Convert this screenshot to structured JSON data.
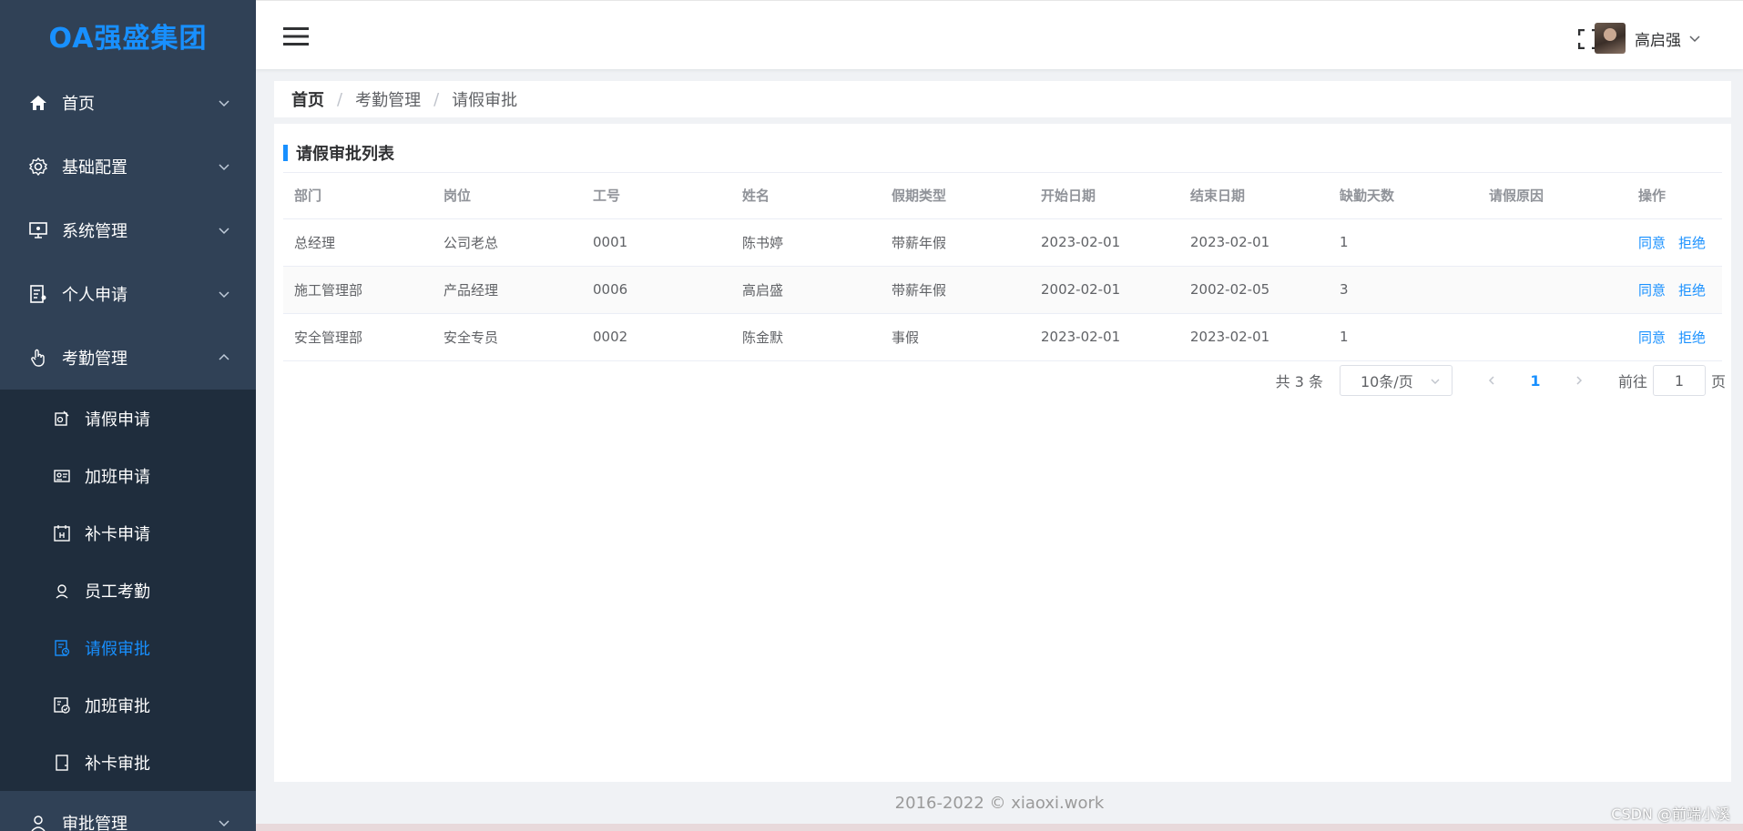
{
  "app": {
    "logo_text": "OA强盛集团"
  },
  "sidebar": {
    "items": [
      {
        "label": "首页",
        "icon": "home-icon"
      },
      {
        "label": "基础配置",
        "icon": "gear-icon"
      },
      {
        "label": "系统管理",
        "icon": "monitor-icon"
      },
      {
        "label": "个人申请",
        "icon": "document-user-icon"
      },
      {
        "label": "考勤管理",
        "icon": "hand-pointer-icon",
        "expanded": true
      }
    ],
    "subitems": [
      {
        "label": "请假申请",
        "icon": "leave-request-icon"
      },
      {
        "label": "加班申请",
        "icon": "overtime-request-icon"
      },
      {
        "label": "补卡申请",
        "icon": "card-request-icon"
      },
      {
        "label": "员工考勤",
        "icon": "employee-icon"
      },
      {
        "label": "请假审批",
        "icon": "leave-approval-icon",
        "active": true
      },
      {
        "label": "加班审批",
        "icon": "overtime-approval-icon"
      },
      {
        "label": "补卡审批",
        "icon": "card-approval-icon"
      }
    ],
    "next_item": {
      "label": "审批管理",
      "icon": "user-icon"
    }
  },
  "header": {
    "user_name": "高启强"
  },
  "breadcrumb": [
    "首页",
    "考勤管理",
    "请假审批"
  ],
  "card": {
    "title": "请假审批列表"
  },
  "table": {
    "columns": [
      "部门",
      "岗位",
      "工号",
      "姓名",
      "假期类型",
      "开始日期",
      "结束日期",
      "缺勤天数",
      "请假原因",
      "操作"
    ],
    "rows": [
      [
        "总经理",
        "公司老总",
        "0001",
        "陈书婷",
        "带薪年假",
        "2023-02-01",
        "2023-02-01",
        "1",
        ""
      ],
      [
        "施工管理部",
        "产品经理",
        "0006",
        "高启盛",
        "带薪年假",
        "2002-02-01",
        "2002-02-05",
        "3",
        ""
      ],
      [
        "安全管理部",
        "安全专员",
        "0002",
        "陈金默",
        "事假",
        "2023-02-01",
        "2023-02-01",
        "1",
        ""
      ]
    ],
    "actions": {
      "approve": "同意",
      "reject": "拒绝"
    }
  },
  "pagination": {
    "total": "共 3 条",
    "page_size": "10条/页",
    "current_page": "1",
    "goto_label": "前往",
    "goto_value": "1",
    "page_suffix": "页"
  },
  "footer": {
    "text": "2016-2022 © xiaoxi.work"
  },
  "watermark": "CSDN @前端小溪",
  "colors": {
    "sidebar_bg": "#304156",
    "accent": "#1890ff"
  }
}
